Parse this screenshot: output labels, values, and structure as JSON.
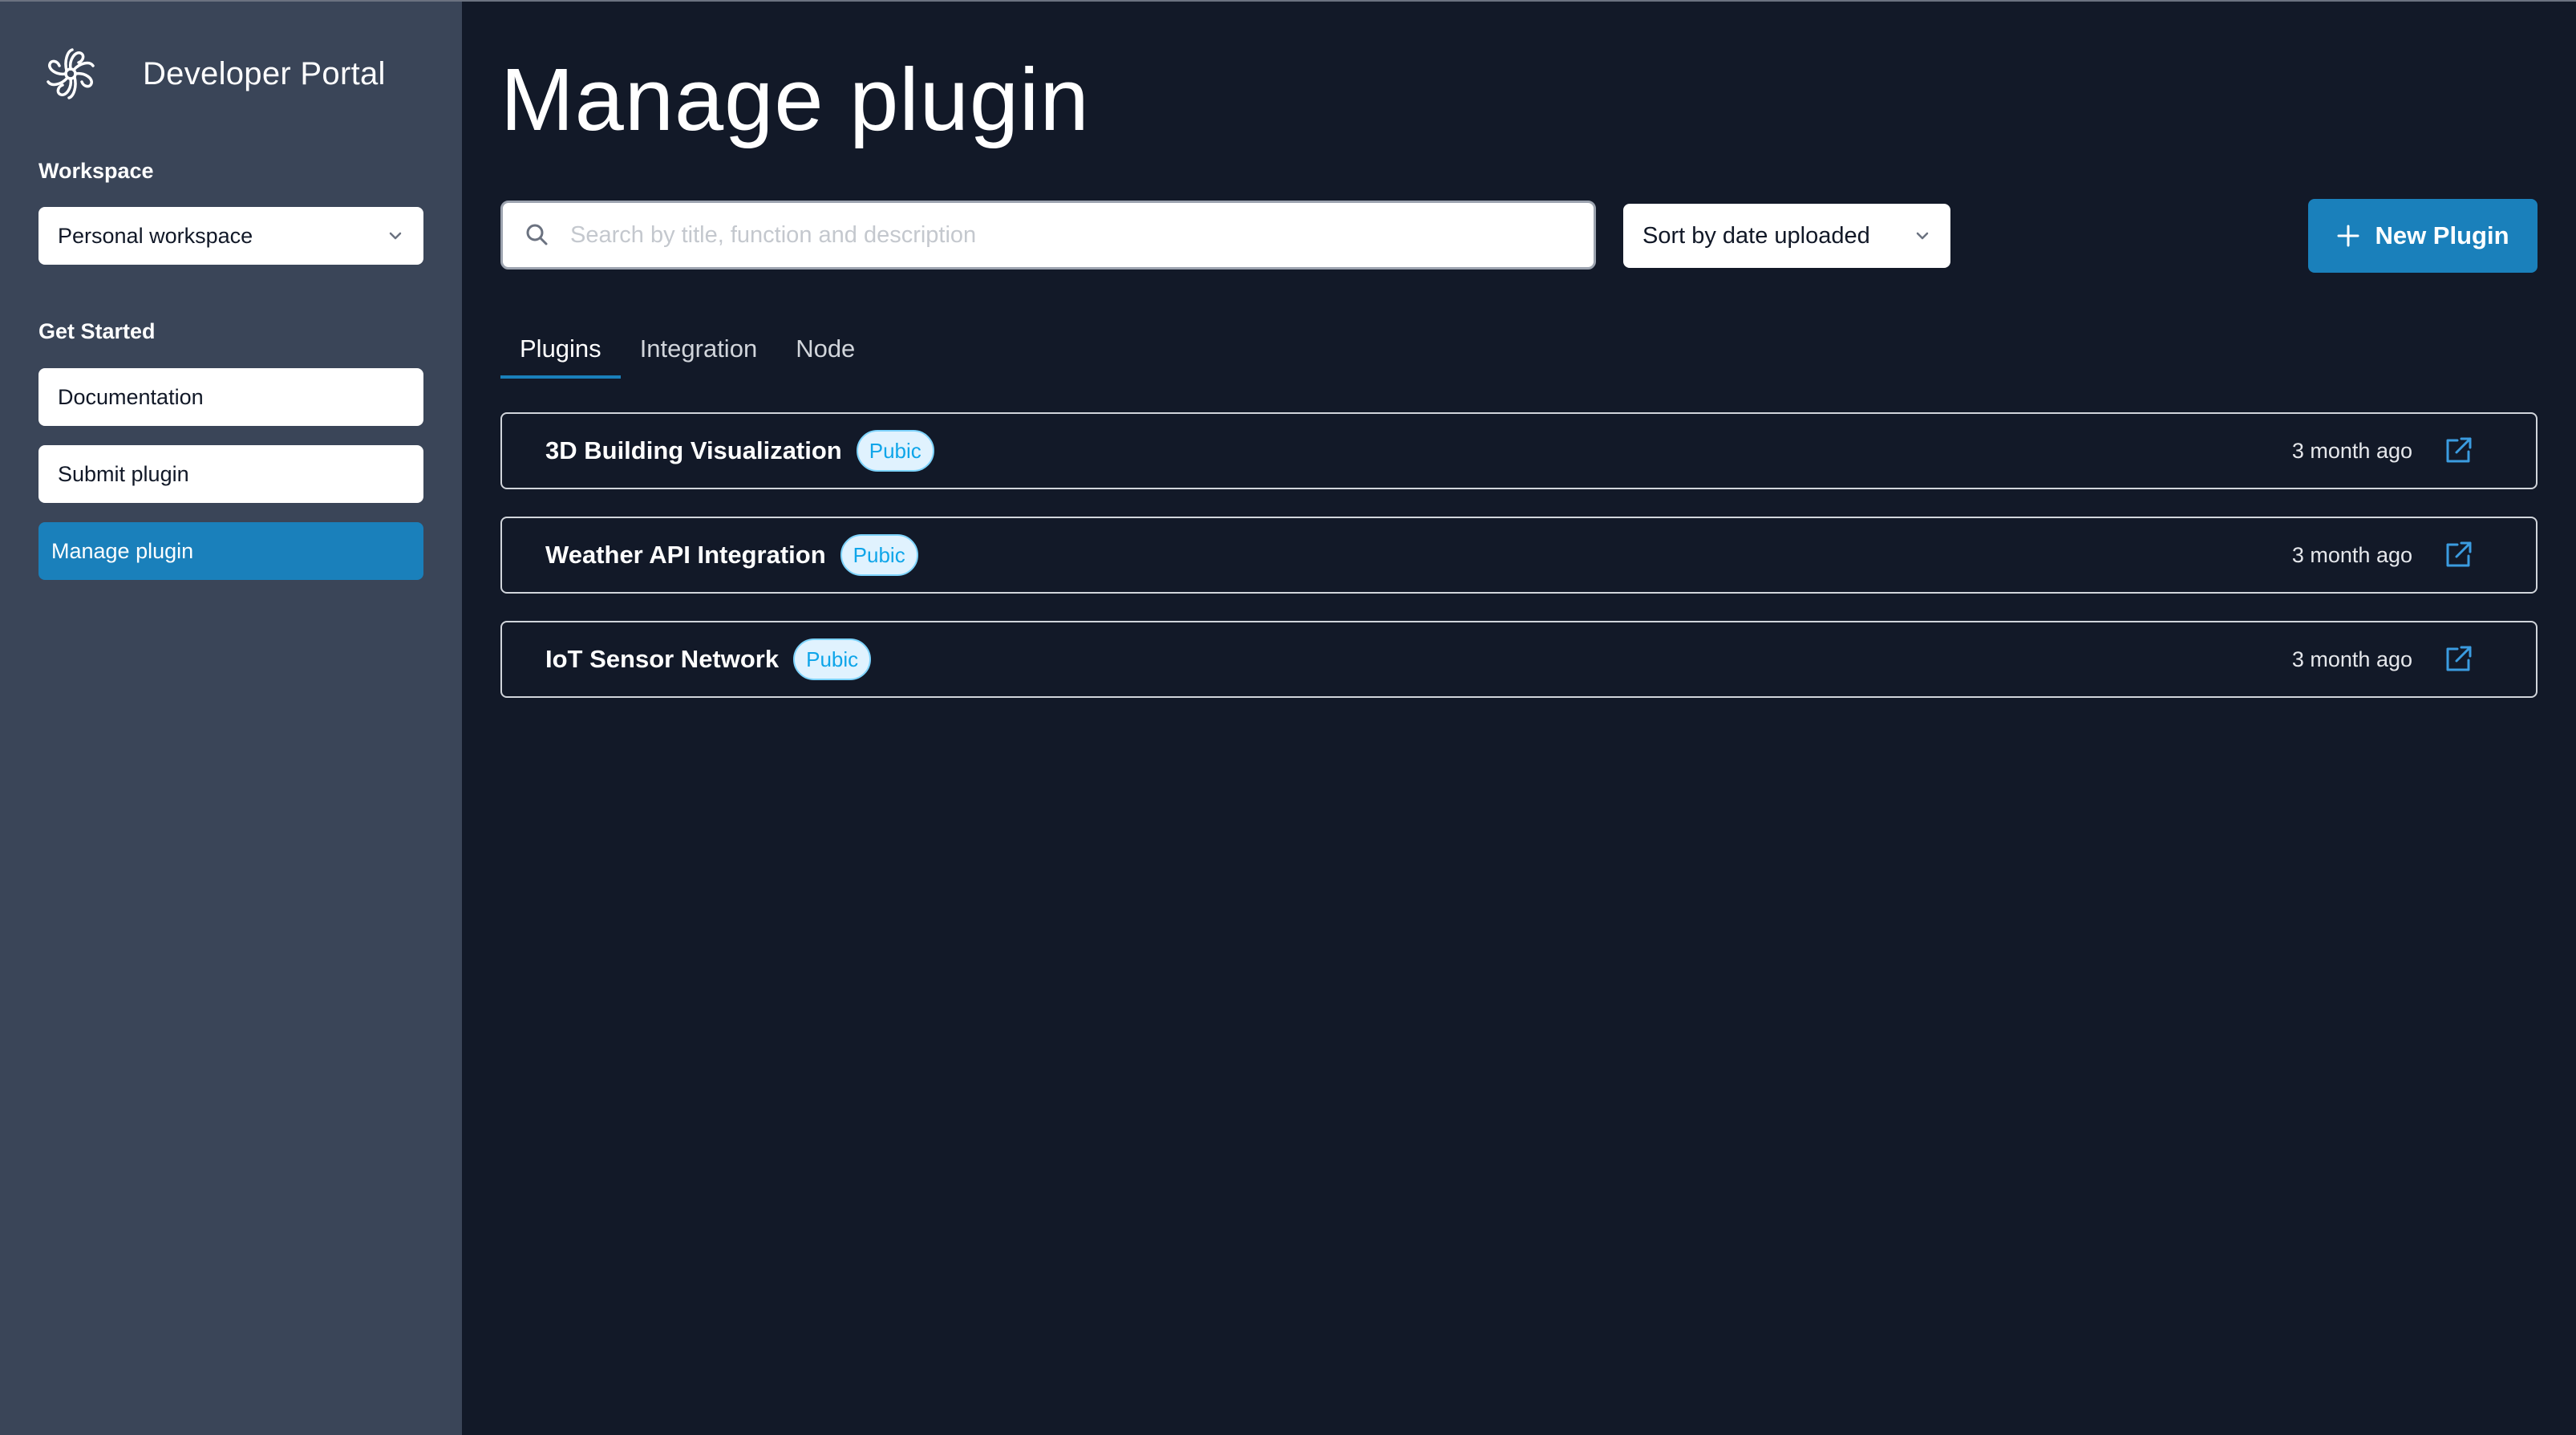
{
  "app": {
    "brand_title": "Developer Portal"
  },
  "sidebar": {
    "workspace_label": "Workspace",
    "workspace_value": "Personal workspace",
    "get_started_label": "Get Started",
    "items": [
      {
        "label": "Documentation"
      },
      {
        "label": "Submit plugin"
      },
      {
        "label": "Manage plugin",
        "active": true
      }
    ]
  },
  "main": {
    "title": "Manage plugin",
    "search": {
      "placeholder": "Search by title, function and description",
      "icon": "search-icon"
    },
    "sort": {
      "label": "Sort by date uploaded",
      "icon": "chevron-down-icon"
    },
    "new_button": {
      "label": "New Plugin",
      "icon": "plus-icon"
    },
    "tabs": [
      {
        "label": "Plugins",
        "active": true
      },
      {
        "label": "Integration"
      },
      {
        "label": "Node"
      }
    ],
    "plugins": [
      {
        "name": "3D Building Visualization",
        "badge": "Pubic",
        "time": "3 month ago",
        "icon": "external-link-icon"
      },
      {
        "name": "Weather API Integration",
        "badge": "Pubic",
        "time": "3 month ago",
        "icon": "external-link-icon"
      },
      {
        "name": "IoT Sensor Network",
        "badge": "Pubic",
        "time": "3 month ago",
        "icon": "external-link-icon"
      }
    ]
  },
  "colors": {
    "background": "#121928",
    "sidebar": "#3a4558",
    "accent": "#1a80bb",
    "badge_bg": "#e0f2fe",
    "badge_text": "#0ea5e9"
  }
}
